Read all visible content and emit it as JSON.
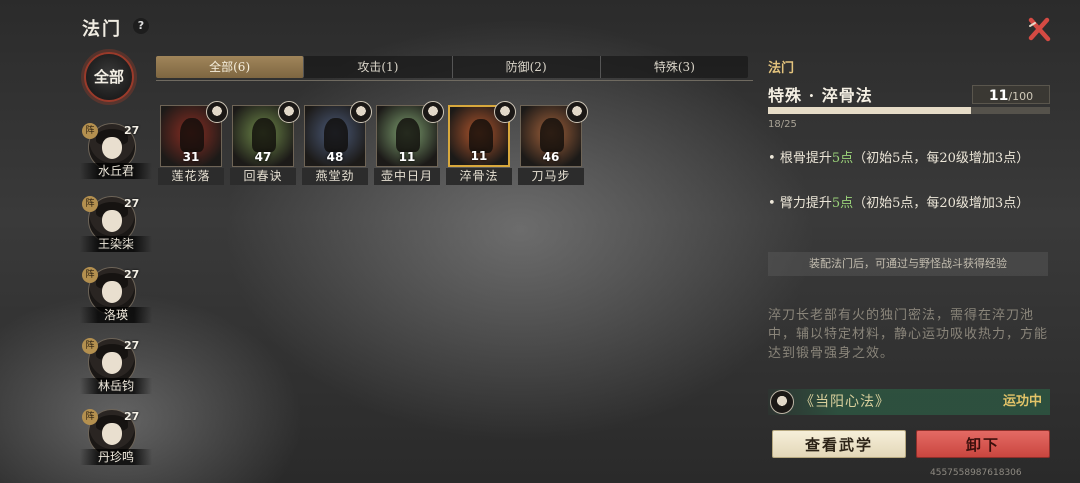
{
  "header": {
    "title": "法门",
    "help_glyph": "?"
  },
  "filter_all": "全部",
  "characters": [
    {
      "name": "水丘君",
      "level": "27",
      "badge": "阵"
    },
    {
      "name": "王染柒",
      "level": "27",
      "badge": "阵"
    },
    {
      "name": "洛瑛",
      "level": "27",
      "badge": "阵"
    },
    {
      "name": "林岳钧",
      "level": "27",
      "badge": "阵"
    },
    {
      "name": "丹珍鸣",
      "level": "27",
      "badge": "阵"
    }
  ],
  "tabs": [
    {
      "label": "全部(6)",
      "active": true
    },
    {
      "label": "攻击(1)",
      "active": false
    },
    {
      "label": "防御(2)",
      "active": false
    },
    {
      "label": "特殊(3)",
      "active": false
    }
  ],
  "skills": [
    {
      "name": "莲花落",
      "count": "31",
      "color": "#8a2d22"
    },
    {
      "name": "回春诀",
      "count": "47",
      "color": "#6f8a4a"
    },
    {
      "name": "燕堂劲",
      "count": "48",
      "color": "#4b5a78"
    },
    {
      "name": "壶中日月",
      "count": "11",
      "color": "#7ea070"
    },
    {
      "name": "淬骨法",
      "count": "11",
      "color": "#b0552c"
    },
    {
      "name": "刀马步",
      "count": "46",
      "color": "#a0603a"
    }
  ],
  "selected_skill_index": 4,
  "detail": {
    "heading": "法门",
    "title": "特殊 · 淬骨法",
    "level_current": "11",
    "level_max": "/100",
    "exp_text": "18/25",
    "exp_fraction": 0.72,
    "effects": [
      {
        "bullet": "•",
        "pre": "根骨提升",
        "value": "5点",
        "post": "（初始5点，每20级增加3点）"
      },
      {
        "bullet": "•",
        "pre": "臂力提升",
        "value": "5点",
        "post": "（初始5点，每20级增加3点）"
      }
    ],
    "hint": "装配法门后，可通过与野怪战斗获得经验",
    "description": "淬刀长老部有火的独门密法，需得在淬刀池中，辅以特定材料，静心运功吸收热力，方能达到锻骨强身之效。",
    "cultivation": {
      "method": "《当阳心法》",
      "status": "运功中"
    },
    "view_button": "查看武学",
    "unequip_button": "卸下"
  },
  "uid": "4557558987618306",
  "colors": {
    "accent_gold": "#e3c37d",
    "highlight_green": "#9bd37a",
    "danger_red": "#d6524b"
  }
}
